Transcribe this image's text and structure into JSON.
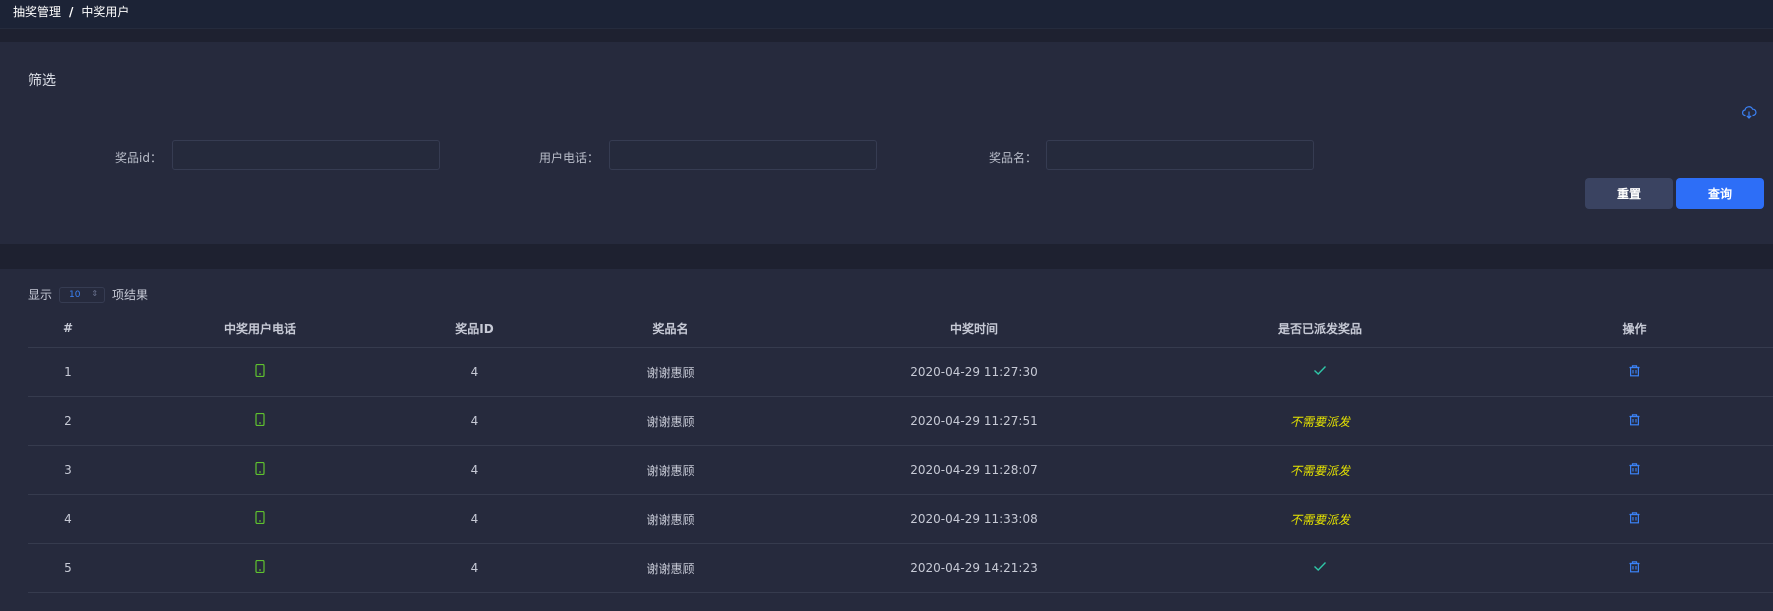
{
  "breadcrumb": {
    "parent": "抽奖管理",
    "separator": "/",
    "current": "中奖用户"
  },
  "filter": {
    "title": "筛选",
    "fields": [
      {
        "label": "奖品id：",
        "value": ""
      },
      {
        "label": "用户电话：",
        "value": ""
      },
      {
        "label": "奖品名：",
        "value": ""
      }
    ],
    "reset_label": "重置",
    "query_label": "查询",
    "export_icon": "cloud-download-icon"
  },
  "table": {
    "show_label": "显示",
    "page_size": "10",
    "results_label": "项结果",
    "columns": [
      "#",
      "中奖用户电话",
      "奖品ID",
      "奖品名",
      "中奖时间",
      "是否已派发奖品",
      "操作"
    ],
    "rows": [
      {
        "index": "1",
        "phone_icon": "phone-icon",
        "prize_id": "4",
        "prize_name": "谢谢惠顾",
        "time": "2020-04-29 11:27:30",
        "status": "check",
        "status_text": ""
      },
      {
        "index": "2",
        "phone_icon": "phone-icon",
        "prize_id": "4",
        "prize_name": "谢谢惠顾",
        "time": "2020-04-29 11:27:51",
        "status": "text",
        "status_text": "不需要派发"
      },
      {
        "index": "3",
        "phone_icon": "phone-icon",
        "prize_id": "4",
        "prize_name": "谢谢惠顾",
        "time": "2020-04-29 11:28:07",
        "status": "text",
        "status_text": "不需要派发"
      },
      {
        "index": "4",
        "phone_icon": "phone-icon",
        "prize_id": "4",
        "prize_name": "谢谢惠顾",
        "time": "2020-04-29 11:33:08",
        "status": "text",
        "status_text": "不需要派发"
      },
      {
        "index": "5",
        "phone_icon": "phone-icon",
        "prize_id": "4",
        "prize_name": "谢谢惠顾",
        "time": "2020-04-29 14:21:23",
        "status": "check",
        "status_text": ""
      }
    ]
  },
  "colors": {
    "background": "#1e2130",
    "panel": "#262a3d",
    "accent": "#2d6ef7",
    "phone_icon": "#5fc22f",
    "check": "#2fc7a8",
    "status_text": "#e5e300",
    "delete_icon": "#3b82f6"
  }
}
